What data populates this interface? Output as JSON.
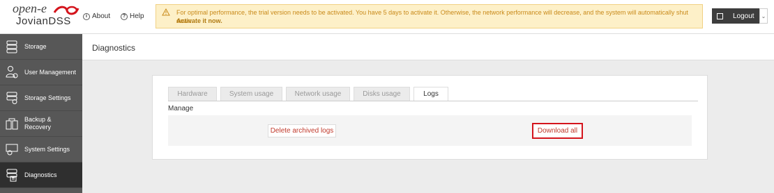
{
  "header": {
    "brand_top": "open-e",
    "brand_bottom": "JovianDSS",
    "about": "About",
    "help": "Help",
    "logout": "Logout"
  },
  "alert": {
    "message": "For optimal performance, the trial version needs to be activated. You have 5 days to activate it. Otherwise, the network performance will decrease, and the system will automatically shut down.",
    "action": "Activate it now",
    "action_suffix": "."
  },
  "sidebar": {
    "items": [
      {
        "label": "Storage"
      },
      {
        "label": "User Management"
      },
      {
        "label": "Storage Settings"
      },
      {
        "label": "Backup &\nRecovery"
      },
      {
        "label": "System Settings"
      },
      {
        "label": "Diagnostics"
      }
    ]
  },
  "page": {
    "title": "Diagnostics"
  },
  "tabs": [
    {
      "label": "Hardware"
    },
    {
      "label": "System usage"
    },
    {
      "label": "Network usage"
    },
    {
      "label": "Disks usage"
    },
    {
      "label": "Logs"
    }
  ],
  "manage": {
    "heading": "Manage",
    "delete_label": "Delete archived logs",
    "download_label": "Download all"
  },
  "colors": {
    "accent_red": "#c0392b",
    "highlight": "#d4141c",
    "sidebar": "#575757",
    "sidebar_active": "#2f2f2f",
    "alert_bg": "#fdf0c8"
  }
}
